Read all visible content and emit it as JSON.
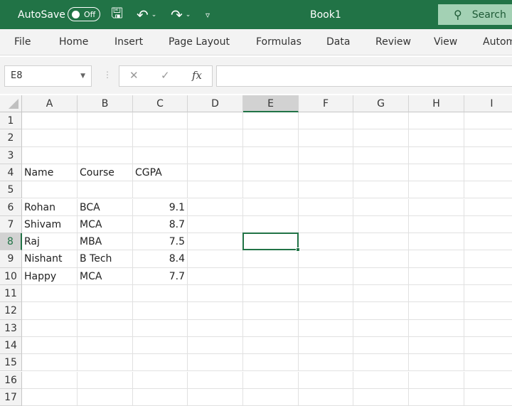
{
  "titlebar": {
    "autosave_label": "AutoSave",
    "autosave_state": "Off",
    "title": "Book1",
    "search_label": "Search",
    "accent": "#217346"
  },
  "ribbon": {
    "tabs": [
      "File",
      "Home",
      "Insert",
      "Page Layout",
      "Formulas",
      "Data",
      "Review",
      "View",
      "Autom"
    ]
  },
  "formula_bar": {
    "name_box": "E8",
    "fx_label": "fx",
    "value": ""
  },
  "sheet": {
    "columns": [
      "A",
      "B",
      "C",
      "D",
      "E",
      "F",
      "G",
      "H",
      "I"
    ],
    "row_numbers": [
      "1",
      "2",
      "3",
      "4",
      "5",
      "6",
      "7",
      "8",
      "9",
      "10",
      "11",
      "12",
      "13",
      "14",
      "15",
      "16",
      "17"
    ],
    "selected_cell": "E8",
    "cells": [
      {
        "row": 4,
        "col": "A",
        "value": "Name"
      },
      {
        "row": 4,
        "col": "B",
        "value": "Course"
      },
      {
        "row": 4,
        "col": "C",
        "value": "CGPA"
      },
      {
        "row": 6,
        "col": "A",
        "value": "Rohan"
      },
      {
        "row": 6,
        "col": "B",
        "value": "BCA"
      },
      {
        "row": 6,
        "col": "C",
        "value": "9.1",
        "numeric": true
      },
      {
        "row": 7,
        "col": "A",
        "value": "Shivam"
      },
      {
        "row": 7,
        "col": "B",
        "value": "MCA"
      },
      {
        "row": 7,
        "col": "C",
        "value": "8.7",
        "numeric": true
      },
      {
        "row": 8,
        "col": "A",
        "value": "Raj"
      },
      {
        "row": 8,
        "col": "B",
        "value": "MBA"
      },
      {
        "row": 8,
        "col": "C",
        "value": "7.5",
        "numeric": true
      },
      {
        "row": 9,
        "col": "A",
        "value": "Nishant"
      },
      {
        "row": 9,
        "col": "B",
        "value": "B Tech"
      },
      {
        "row": 9,
        "col": "C",
        "value": "8.4",
        "numeric": true
      },
      {
        "row": 10,
        "col": "A",
        "value": "Happy"
      },
      {
        "row": 10,
        "col": "B",
        "value": "MCA"
      },
      {
        "row": 10,
        "col": "C",
        "value": "7.7",
        "numeric": true
      }
    ]
  }
}
